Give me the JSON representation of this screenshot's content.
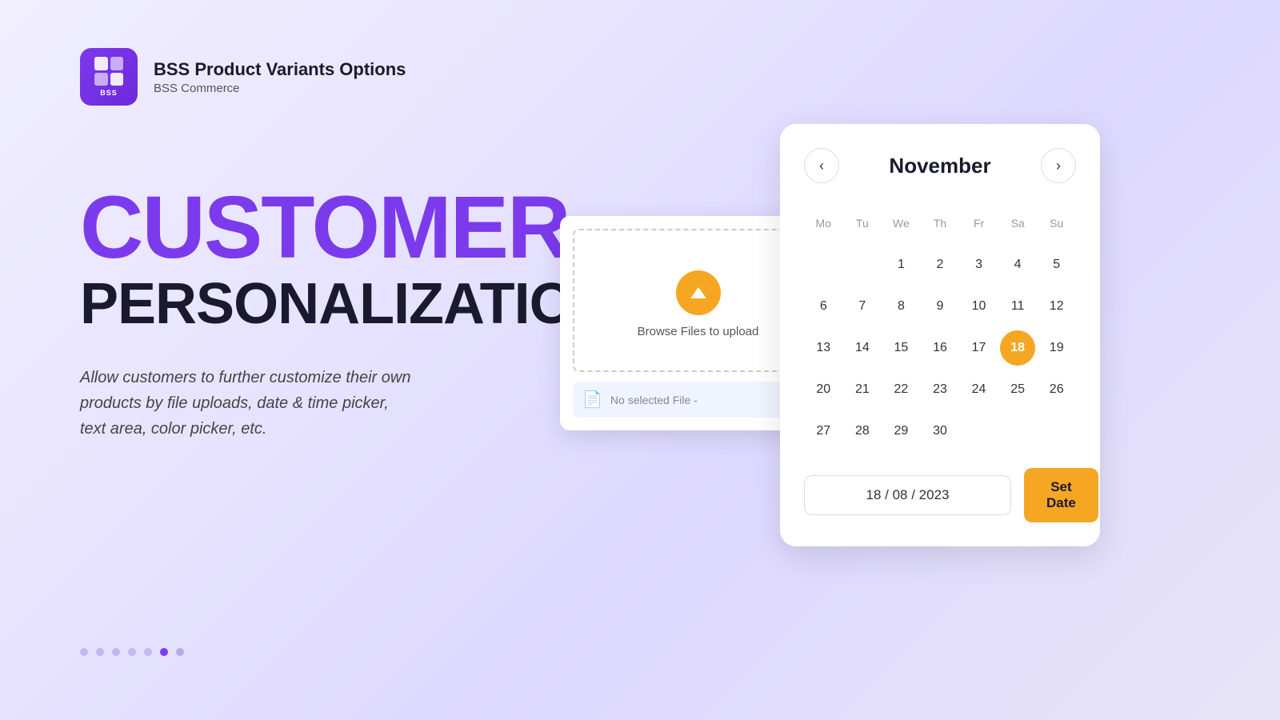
{
  "header": {
    "app_name": "BSS Product Variants Options",
    "company": "BSS Commerce",
    "logo_label": "BSS"
  },
  "hero": {
    "title_line1": "CUSTOMER",
    "title_line2": "PERSONALIZATION",
    "description": "Allow customers to further customize their own products by file uploads, date & time picker, text area, color picker, etc."
  },
  "pagination": {
    "dots": [
      {
        "id": 1,
        "active": false
      },
      {
        "id": 2,
        "active": false
      },
      {
        "id": 3,
        "active": false
      },
      {
        "id": 4,
        "active": false
      },
      {
        "id": 5,
        "active": false
      },
      {
        "id": 6,
        "active": true
      },
      {
        "id": 7,
        "active": false
      }
    ]
  },
  "file_upload": {
    "browse_label": "Browse Files to upload",
    "no_file_label": "No selected File -"
  },
  "calendar": {
    "month": "November",
    "prev_label": "‹",
    "next_label": "›",
    "day_headers": [
      "Mo",
      "Tu",
      "We",
      "Th",
      "Fr",
      "Sa",
      "Su"
    ],
    "weeks": [
      [
        "",
        "",
        "",
        "",
        "1",
        "2",
        "3",
        "4",
        "5"
      ],
      [
        "7",
        "8",
        "9",
        "10",
        "11",
        "12"
      ],
      [
        "14",
        "15",
        "16",
        "17",
        "18",
        "19"
      ],
      [
        "21",
        "22",
        "23",
        "24",
        "25",
        "26"
      ],
      [
        "27",
        "28",
        "29",
        "30"
      ]
    ],
    "selected_day": "18",
    "date_value": "18 / 08 / 2023",
    "set_date_label": "Set Date"
  }
}
